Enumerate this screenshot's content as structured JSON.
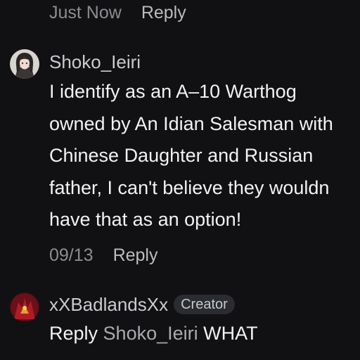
{
  "top_comment_meta": {
    "time": "Just Now",
    "reply_label": "Reply"
  },
  "comment_1": {
    "avatar_icon": "user-avatar-anime-girl-icon",
    "username": "Shoko_Ieiri",
    "lines": [
      "I identify as an A–10 Warthog",
      "owned by An Idian Salesman with",
      "Chinese Daughter and Russian",
      "father, I can't believe they wouldn",
      "have that as an option!"
    ],
    "time": "09/13",
    "reply_label": "Reply"
  },
  "comment_2": {
    "avatar_icon": "user-avatar-red-figure-icon",
    "username": "xXBadlandsXx",
    "badge": "Creator",
    "reply_prefix": "Reply",
    "reply_target": "Shoko_Ieiri",
    "reply_text": "WHAT"
  },
  "colors": {
    "background": "#111113",
    "primary_text": "#f2f2f4",
    "secondary_text": "#8b8d92",
    "badge_bg": "#2b2c30"
  }
}
